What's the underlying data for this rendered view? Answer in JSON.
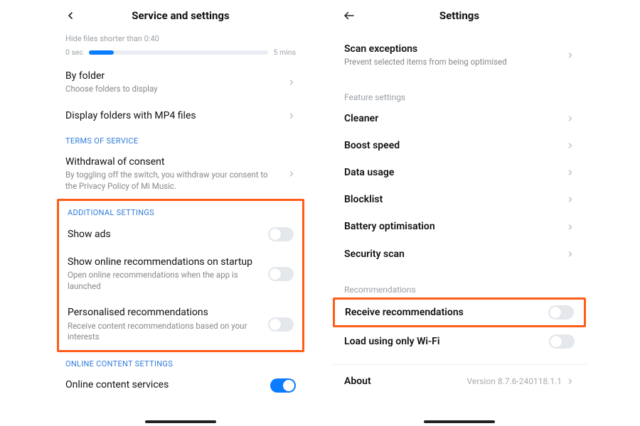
{
  "left": {
    "header": {
      "title": "Service and settings"
    },
    "slider": {
      "hint": "Hide files shorter than 0:40",
      "min": "0 sec",
      "max": "5 mins"
    },
    "byFolder": {
      "title": "By folder",
      "sub": "Choose folders to display"
    },
    "displayMp4": {
      "title": "Display folders with MP4 files"
    },
    "tosCaption": "TERMS OF SERVICE",
    "withdrawal": {
      "title": "Withdrawal of consent",
      "sub": "By toggling off the switch, you withdraw your consent to the Privacy Policy of Mi Music."
    },
    "addlCaption": "ADDITIONAL SETTINGS",
    "showAds": {
      "title": "Show ads"
    },
    "onlineRecs": {
      "title": "Show online recommendations on startup",
      "sub": "Open online recommendations when the app is launched"
    },
    "personalised": {
      "title": "Personalised recommendations",
      "sub": "Receive content recommendations based on your interests"
    },
    "onlineCaption": "ONLINE CONTENT SETTINGS",
    "onlineServices": {
      "title": "Online content services"
    }
  },
  "right": {
    "header": {
      "title": "Settings"
    },
    "scanExceptions": {
      "title": "Scan exceptions",
      "sub": "Prevent selected items from being optimised"
    },
    "featureCaption": "Feature settings",
    "features": {
      "cleaner": "Cleaner",
      "boost": "Boost speed",
      "dataUsage": "Data usage",
      "blocklist": "Blocklist",
      "battery": "Battery optimisation",
      "security": "Security scan"
    },
    "recsCaption": "Recommendations",
    "receiveRecs": {
      "title": "Receive recommendations"
    },
    "wifiOnly": {
      "title": "Load using only Wi-Fi"
    },
    "about": {
      "title": "About",
      "version": "Version 8.7.6-240118.1.1"
    }
  }
}
